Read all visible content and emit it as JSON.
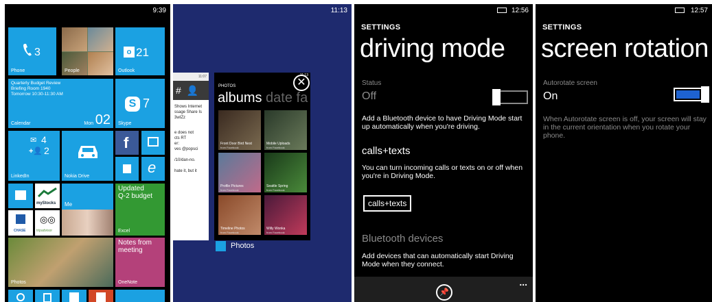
{
  "start": {
    "time": "9:39",
    "tiles": {
      "phone": {
        "count": "3",
        "label": "Phone"
      },
      "people": {
        "label": "People"
      },
      "outlook": {
        "count": "21",
        "label": "Outlook"
      },
      "calendar": {
        "line1": "Quarterly Budget Review",
        "line2": "Briefing Room 1940",
        "line3": "Tomorrow 10:30-11:30 AM",
        "label": "Calendar",
        "day": "Mon",
        "date": "02"
      },
      "skype": {
        "count": "7",
        "label": "Skype"
      },
      "linkedin": {
        "mail": "4",
        "people": "2",
        "label": "LinkedIn"
      },
      "nokia_drive": {
        "label": "Nokia Drive"
      },
      "mystocks": {
        "label": "myStocks"
      },
      "me": {
        "label": "Me"
      },
      "excel": {
        "line1": "Updated",
        "line2": "Q-2 budget",
        "label": "Excel"
      },
      "chase": {
        "label": "CHASE"
      },
      "tripadvisor": {
        "label": "tripadvisor"
      },
      "photos": {
        "label": "Photos"
      },
      "onenote": {
        "line1": "Notes from",
        "line2": "meeting",
        "label": "OneNote"
      }
    },
    "colors": {
      "cyan": "#1ba1e2",
      "green": "#339933",
      "magenta": "#b4417a",
      "red": "#d24726"
    }
  },
  "switcher": {
    "time": "11:13",
    "left_card": {
      "time": "11:07",
      "lines": [
        "Shows Internet",
        "ssage Share Is",
        "3wIZz",
        "e does not",
        "cts RT",
        "er:",
        "ves @popsci",
        "/10/dan-no.",
        "hate it, but it"
      ]
    },
    "photos_card": {
      "time": "11:13",
      "header": "PHOTOS",
      "pivot_active": "albums",
      "pivot_next": "date fa",
      "albums": [
        {
          "title": "Front Door Bird Nest",
          "source": "from Facebook"
        },
        {
          "title": "Mobile Uploads",
          "source": "from Facebook"
        },
        {
          "title": "Profile Pictures",
          "source": "from Facebook"
        },
        {
          "title": "Seattle Spring",
          "source": "from Facebook"
        },
        {
          "title": "Timeline Photos",
          "source": "from Facebook"
        },
        {
          "title": "Willy Wonka",
          "source": "from Facebook"
        }
      ]
    },
    "app_label": "Photos"
  },
  "driving": {
    "time": "12:56",
    "header": "SETTINGS",
    "title": "driving mode",
    "status_label": "Status",
    "status_value": "Off",
    "status_on": false,
    "desc1": "Add a Bluetooth device to have Driving Mode start up automatically when you're driving.",
    "calls_header": "calls+texts",
    "calls_desc": "You can turn incoming calls or texts on or off when you're in Driving Mode.",
    "calls_button": "calls+texts",
    "bt_header": "Bluetooth devices",
    "bt_desc": "Add devices that can automatically start Driving Mode when they connect.",
    "more": "..."
  },
  "rotation": {
    "time": "12:57",
    "header": "SETTINGS",
    "title": "screen rotation",
    "label": "Autorotate screen",
    "value": "On",
    "on": true,
    "desc": "When Autorotate screen is off, your screen will stay in the current orientation when you rotate your phone.",
    "accent": "#1e62d0"
  }
}
